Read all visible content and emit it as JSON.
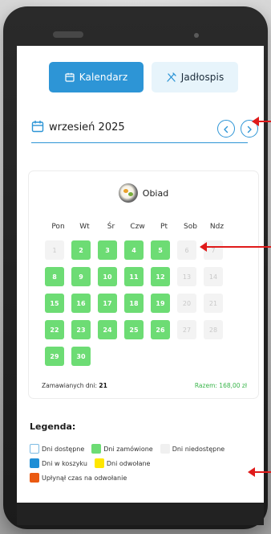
{
  "tabs": {
    "calendar": "Kalendarz",
    "menu": "Jadłospis"
  },
  "month": {
    "label": "wrzesień 2025"
  },
  "meal": {
    "label": "Obiad"
  },
  "weekdays": [
    "Pon",
    "Wt",
    "Śr",
    "Czw",
    "Pt",
    "Sob",
    "Ndz"
  ],
  "days": [
    {
      "n": "1",
      "s": "unavailable"
    },
    {
      "n": "2",
      "s": "ordered"
    },
    {
      "n": "3",
      "s": "ordered"
    },
    {
      "n": "4",
      "s": "ordered"
    },
    {
      "n": "5",
      "s": "ordered"
    },
    {
      "n": "6",
      "s": "unavailable"
    },
    {
      "n": "7",
      "s": "unavailable"
    },
    {
      "n": "8",
      "s": "ordered"
    },
    {
      "n": "9",
      "s": "ordered"
    },
    {
      "n": "10",
      "s": "ordered"
    },
    {
      "n": "11",
      "s": "ordered"
    },
    {
      "n": "12",
      "s": "ordered"
    },
    {
      "n": "13",
      "s": "unavailable"
    },
    {
      "n": "14",
      "s": "unavailable"
    },
    {
      "n": "15",
      "s": "ordered"
    },
    {
      "n": "16",
      "s": "ordered"
    },
    {
      "n": "17",
      "s": "ordered"
    },
    {
      "n": "18",
      "s": "ordered"
    },
    {
      "n": "19",
      "s": "ordered"
    },
    {
      "n": "20",
      "s": "unavailable"
    },
    {
      "n": "21",
      "s": "unavailable"
    },
    {
      "n": "22",
      "s": "ordered"
    },
    {
      "n": "23",
      "s": "ordered"
    },
    {
      "n": "24",
      "s": "ordered"
    },
    {
      "n": "25",
      "s": "ordered"
    },
    {
      "n": "26",
      "s": "ordered"
    },
    {
      "n": "27",
      "s": "unavailable"
    },
    {
      "n": "28",
      "s": "unavailable"
    },
    {
      "n": "29",
      "s": "ordered"
    },
    {
      "n": "30",
      "s": "ordered"
    }
  ],
  "summary": {
    "ordered_label": "Zamawianych dni:",
    "ordered_count": "21",
    "total_label": "Razem:",
    "total_value": "168,00 zł"
  },
  "legend": {
    "title": "Legenda:",
    "items": [
      {
        "label": "Dni dostępne",
        "color": "#ffffff"
      },
      {
        "label": "Dni zamówione",
        "color": "#6ddc74"
      },
      {
        "label": "Dni niedostępne",
        "color": "#f0f0f0"
      },
      {
        "label": "Dni w koszyku",
        "color": "#1f8fd6"
      },
      {
        "label": "Dni odwołane",
        "color": "#ffe600"
      },
      {
        "label": "Upłynął czas na odwołanie",
        "color": "#ea5a12"
      }
    ]
  },
  "colors": {
    "accent": "#2d95d6",
    "ordered": "#6ddc74",
    "annotation_arrow": "#e01b1b"
  },
  "icons": {
    "calendar_tab": "calendar-icon",
    "menu_tab": "utensils-icon",
    "month": "calendar-icon",
    "prev": "chevron-left-icon",
    "next": "chevron-right-icon",
    "meal": "dish-icon"
  }
}
